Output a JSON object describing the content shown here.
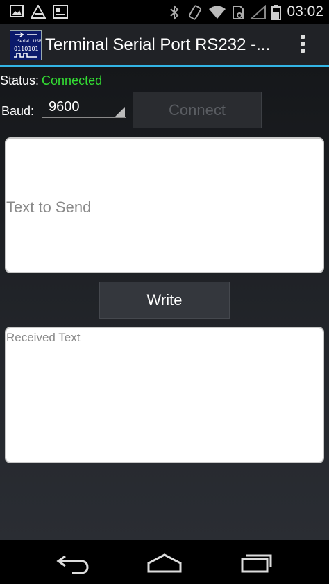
{
  "status_bar": {
    "time": "03:02",
    "left_icons": [
      "image-icon",
      "app-notification-icon",
      "photo-notification-icon"
    ],
    "right_icons": [
      "bluetooth-icon",
      "rotate-icon",
      "wifi-icon",
      "sim-icon",
      "signal-icon",
      "battery-icon"
    ]
  },
  "action_bar": {
    "title": "Terminal Serial Port RS232 -...",
    "icon_text_top": "Serial . USB",
    "icon_text_bottom": "0110101",
    "accent_color": "#33b5e5"
  },
  "status": {
    "label": "Status:",
    "value": "Connected",
    "value_color": "#33dd33"
  },
  "baud": {
    "label": "Baud:",
    "selected": "9600"
  },
  "connect_button": {
    "label": "Connect",
    "enabled": false
  },
  "send_field": {
    "placeholder": "Text to Send",
    "value": ""
  },
  "write_button": {
    "label": "Write"
  },
  "received_field": {
    "placeholder": "Received Text",
    "value": ""
  },
  "nav_bar": {
    "icons": [
      "back-icon",
      "home-icon",
      "recent-apps-icon"
    ]
  }
}
